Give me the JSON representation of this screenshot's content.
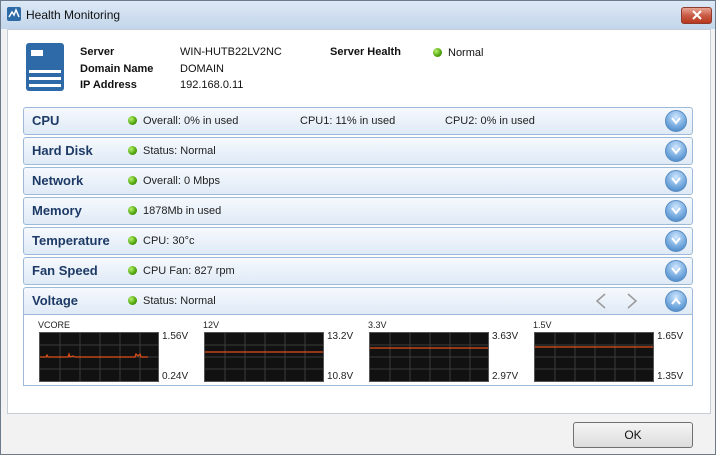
{
  "window": {
    "title": "Health Monitoring"
  },
  "server": {
    "server_label": "Server",
    "server_value": "WIN-HUTB22LV2NC",
    "domain_label": "Domain Name",
    "domain_value": "DOMAIN",
    "ip_label": "IP Address",
    "ip_value": "192.168.0.11",
    "health_label": "Server Health",
    "health_value": "Normal"
  },
  "rows": [
    {
      "title": "CPU",
      "items": [
        "Overall: 0% in used",
        "CPU1: 11% in used",
        "CPU2: 0% in used"
      ]
    },
    {
      "title": "Hard Disk",
      "items": [
        "Status: Normal"
      ]
    },
    {
      "title": "Network",
      "items": [
        "Overall: 0 Mbps"
      ]
    },
    {
      "title": "Memory",
      "items": [
        "1878Mb in used"
      ]
    },
    {
      "title": "Temperature",
      "items": [
        "CPU: 30°c"
      ]
    },
    {
      "title": "Fan Speed",
      "items": [
        "CPU Fan: 827 rpm"
      ]
    },
    {
      "title": "Voltage",
      "items": [
        "Status: Normal"
      ]
    }
  ],
  "voltage_graphs": [
    {
      "name": "VCORE",
      "max": "1.56V",
      "min": "0.24V",
      "level": 0.5
    },
    {
      "name": "12V",
      "max": "13.2V",
      "min": "10.8V",
      "level": 0.5
    },
    {
      "name": "3.3V",
      "max": "3.63V",
      "min": "2.97V",
      "level": 0.5
    },
    {
      "name": "1.5V",
      "max": "1.65V",
      "min": "1.35V",
      "level": 0.5
    }
  ],
  "buttons": {
    "ok": "OK"
  },
  "colors": {
    "status_ok": "#4ea30c",
    "graph_line": "#e0501b",
    "row_title": "#1d3a66"
  },
  "icons": {
    "close": "close-icon",
    "server": "server-icon",
    "expand": "chevron-down-icon",
    "collapse": "chevron-up-icon",
    "prev": "chevron-left-icon",
    "next": "chevron-right-icon"
  }
}
